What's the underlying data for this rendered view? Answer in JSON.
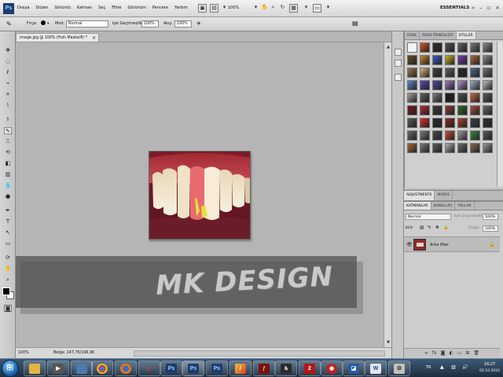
{
  "menubar": {
    "app_logo": "Ps",
    "items": [
      "Dosya",
      "Düzen",
      "Görüntü",
      "Katman",
      "Seç",
      "Filtre",
      "Görünüm",
      "Pencere",
      "Yardım"
    ],
    "zoom": "100%",
    "workspace": "ESSENTIALS",
    "icons": [
      "bridge-icon",
      "minibridge-icon",
      "extras-icon",
      "hand-icon",
      "zoom-icon",
      "rotate-icon",
      "arrange-icon",
      "screen-mode-icon"
    ]
  },
  "options": {
    "brush_label": "Fırça:",
    "mode_label": "Mod:",
    "mode_value": "Normal",
    "opacity_label": "Işık Geçirmezlik:",
    "opacity_value": "100%",
    "flow_label": "Akış:",
    "flow_value": "100%"
  },
  "document": {
    "tab_title": "image.jpg @ 100% (Hızlı Maske/8) *",
    "tab_close": "×",
    "zoom": "100%",
    "doc_info": "Belge: 147,7K/196,9K"
  },
  "watermark": {
    "text": "MK DESIGN"
  },
  "panels": {
    "styles_tabs": [
      "RENK",
      "RENK ÖRNEKLERİ",
      "STİLLER"
    ],
    "adjust_tabs": [
      "ADJUSTMENTS",
      "MASKS"
    ],
    "layers_tabs": [
      "KATMANLAR",
      "KANALLAR",
      "YOLLAR"
    ],
    "blend_mode": "Normal",
    "opacity_label": "Işık Geçirmezlik:",
    "opacity_value": "100%",
    "lock_label": "Kilit:",
    "fill_label": "Dolgu:",
    "fill_value": "100%",
    "layer_name": "Arka Plan",
    "style_colors": [
      "#f4f4f4",
      "#d9541e",
      "#2d2d2d",
      "#505050",
      "#606060",
      "#7a7a7a",
      "#8a8a8a",
      "#6b4b2a",
      "#c98a2a",
      "#3d5ac4",
      "#c8b22a",
      "#7a3bb0",
      "#b06a3a",
      "#8a8a8a",
      "#9b7a4a",
      "#d8b87a",
      "#404040",
      "#606060",
      "#2a2a2a",
      "#4a6a8a",
      "#707070",
      "#5a8ac0",
      "#5a4ab0",
      "#4a4a9a",
      "#9a7ac0",
      "#b090d0",
      "#9ab0d0",
      "#c0c0c0",
      "#a0a0a0",
      "#606060",
      "#7a7a7a",
      "#1a1a1a",
      "#505050",
      "#c8643a",
      "#5a5a5a",
      "#7a1a1a",
      "#b02a2a",
      "#3a3a3a",
      "#8a3a3a",
      "#2a6a2a",
      "#b04a3a",
      "#6a6a6a",
      "#5a5a5a",
      "#e02a2a",
      "#2a2a2a",
      "#8a2a1a",
      "#b0402a",
      "#404040",
      "#303030",
      "#6a6a6a",
      "#7a7a7a",
      "#4a4a4a",
      "#d04a3a",
      "#9a9a9a",
      "#3a8a3a",
      "#5a5a5a",
      "#a06a3a",
      "#7a7a7a",
      "#5a5a5a",
      "#b0b0b0",
      "#6a6a6a",
      "#8a6a4a",
      "#9a9a9a"
    ]
  },
  "taskbar": {
    "apps": [
      "Windows Explorer",
      "Media",
      "Chrome",
      "Firefox",
      "Search",
      "Photoshop",
      "Photoshop",
      "Photoshop",
      "App",
      "Flash",
      "Game",
      "App 2",
      "App 3",
      "App 4",
      "Word",
      "Program"
    ],
    "language": "TR",
    "time": "16:27",
    "date": "02.10.2010"
  }
}
